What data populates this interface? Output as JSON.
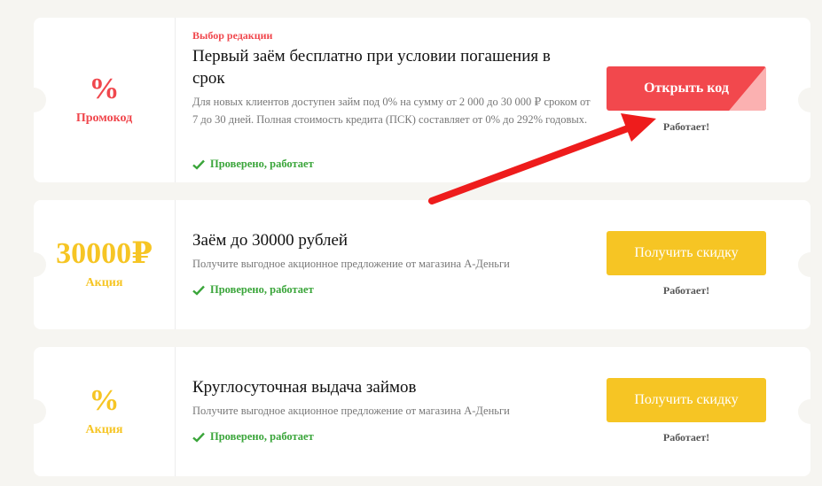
{
  "offers": [
    {
      "big": "%",
      "sub": "Промокод",
      "badge": "Выбор редакции",
      "title": "Первый заём бесплатно при условии погашения в срок",
      "desc": "Для новых клиентов доступен займ под 0% на сумму от 2 000 до 30 000 ₽ сроком от 7 до 30 дней. Полная стоимость кредита (ПСК) составляет от 0% до 292% годовых.",
      "verified": "Проверено, работает",
      "button": "Открыть код",
      "status": "Работает!"
    },
    {
      "big": "30000₽",
      "sub": "Акция",
      "title": "Заём до 30000 рублей",
      "desc": "Получите выгодное акционное предложение от магазина А-Деньги",
      "verified": "Проверено, работает",
      "button": "Получить скидку",
      "status": "Работает!"
    },
    {
      "big": "%",
      "sub": "Акция",
      "title": "Круглосуточная выдача займов",
      "desc": "Получите выгодное акционное предложение от магазина А-Деньги",
      "verified": "Проверено, работает",
      "button": "Получить скидку",
      "status": "Работает!"
    }
  ],
  "colors": {
    "accent_red": "#f2484d",
    "accent_yellow": "#f6c524",
    "verified_green": "#3aa53a",
    "background": "#f6f5f1"
  }
}
